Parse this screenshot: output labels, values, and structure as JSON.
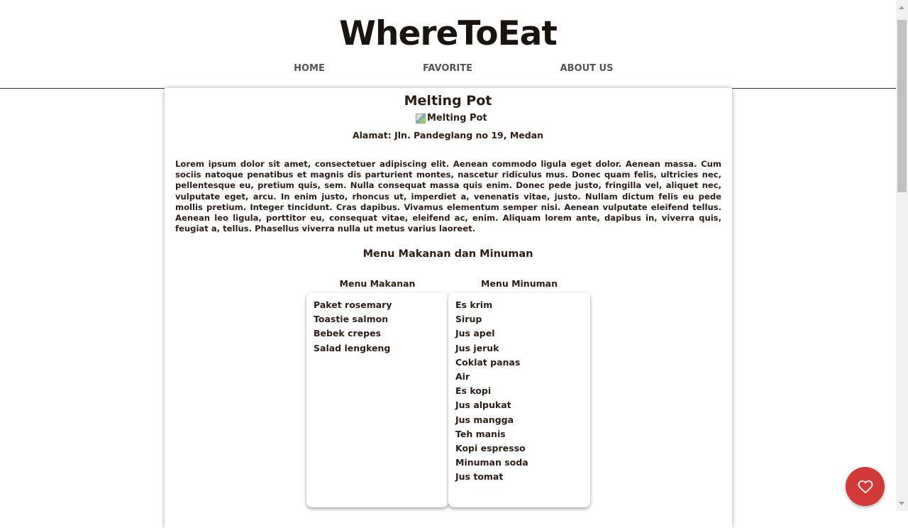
{
  "header": {
    "logo": "WhereToEat",
    "nav": [
      "HOME",
      "FAVORITE",
      "ABOUT US"
    ]
  },
  "restaurant": {
    "name": "Melting Pot",
    "image_alt": "Melting Pot",
    "address": "Alamat: Jln. Pandeglang no 19, Medan",
    "description": "Lorem ipsum dolor sit amet, consectetuer adipiscing elit. Aenean commodo ligula eget dolor. Aenean massa. Cum sociis natoque penatibus et magnis dis parturient montes, nascetur ridiculus mus. Donec quam felis, ultricies nec, pellentesque eu, pretium quis, sem. Nulla consequat massa quis enim. Donec pede justo, fringilla vel, aliquet nec, vulputate eget, arcu. In enim justo, rhoncus ut, imperdiet a, venenatis vitae, justo. Nullam dictum felis eu pede mollis pretium. Integer tincidunt. Cras dapibus. Vivamus elementum semper nisi. Aenean vulputate eleifend tellus. Aenean leo ligula, porttitor eu, consequat vitae, eleifend ac, enim. Aliquam lorem ante, dapibus in, viverra quis, feugiat a, tellus. Phasellus viverra nulla ut metus varius laoreet."
  },
  "menu": {
    "heading": "Menu Makanan dan Minuman",
    "food_label": "Menu Makanan",
    "drink_label": "Menu Minuman",
    "foods": [
      "Paket rosemary",
      "Toastie salmon",
      "Bebek crepes",
      "Salad lengkeng"
    ],
    "drinks": [
      "Es krim",
      "Sirup",
      "Jus apel",
      "Jus jeruk",
      "Coklat panas",
      "Air",
      "Es kopi",
      "Jus alpukat",
      "Jus mangga",
      "Teh manis",
      "Kopi espresso",
      "Minuman soda",
      "Jus tomat"
    ]
  },
  "fab": {
    "icon": "heart-icon",
    "color": "#d23a3a"
  }
}
